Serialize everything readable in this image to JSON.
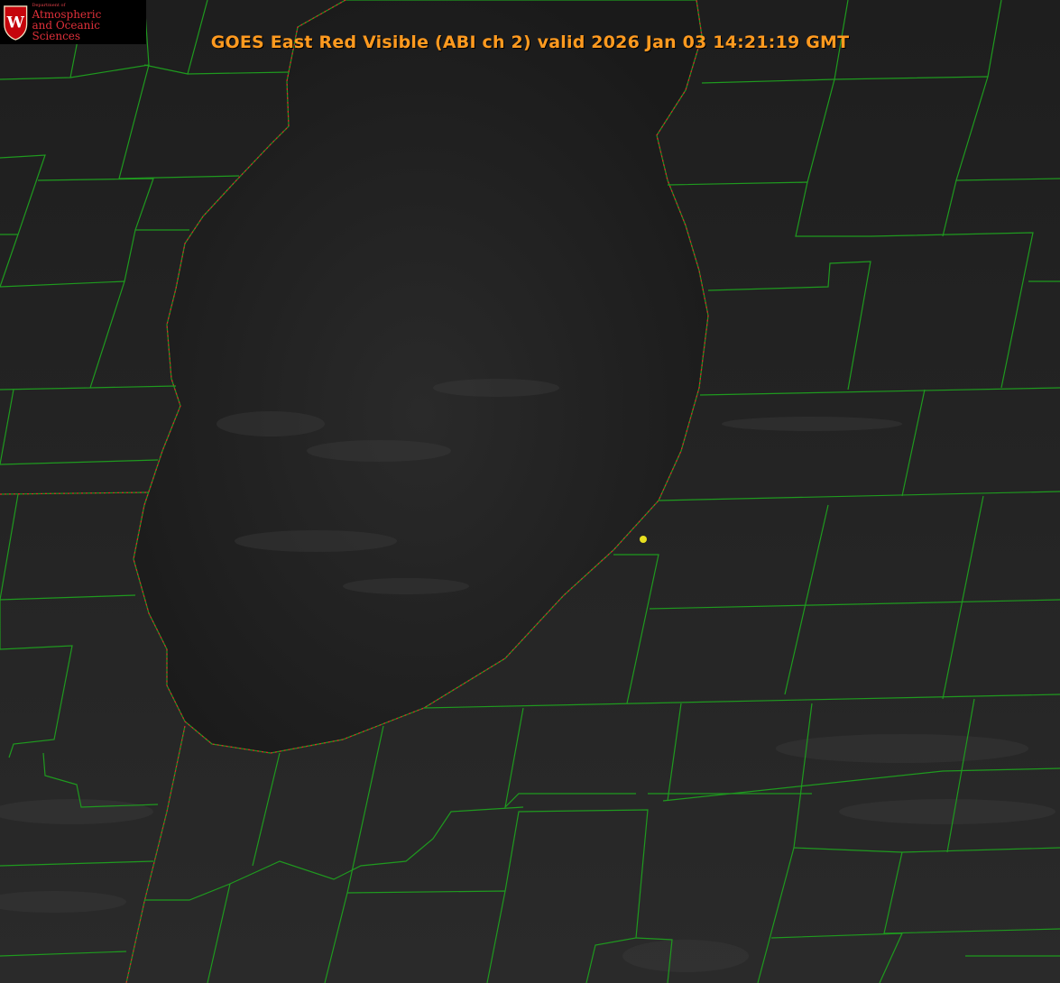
{
  "title": "GOES East Red Visible (ABI ch 2) valid 2026 Jan 03 14:21:19 GMT",
  "logo": {
    "dept": "Department of",
    "line1": "Atmospheric",
    "line2": "and Oceanic Sciences",
    "letter": "W"
  },
  "colors": {
    "background": "#1c1c1c",
    "title": "#ff9a1f",
    "county_lines": "#1f9a1f",
    "coast_dotted": "#e0202a",
    "logo_red": "#e0303a",
    "marker": "#e8e020"
  },
  "icons": [
    "uw-crest-icon",
    "location-marker-icon"
  ]
}
